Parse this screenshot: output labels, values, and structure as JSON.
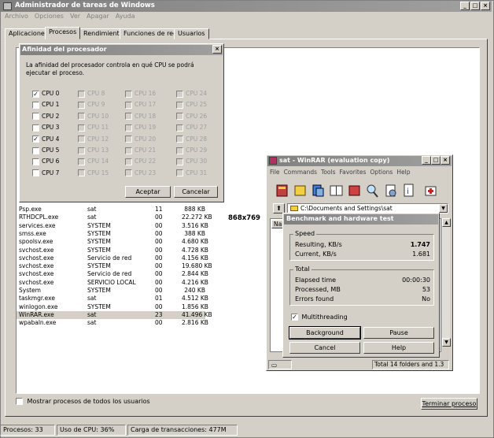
{
  "taskmgr": {
    "title": "Administrador de tareas de Windows",
    "menu": [
      "Archivo",
      "Opciones",
      "Ver",
      "Apagar",
      "Ayuda"
    ],
    "tabs": [
      "Aplicaciones",
      "Procesos",
      "Rendimiento",
      "Funciones de red",
      "Usuarios"
    ],
    "active_tab": "Procesos",
    "processes": [
      {
        "name": "Psp.exe",
        "user": "sat",
        "cpu": "11",
        "mem": "888 KB"
      },
      {
        "name": "RTHDCPL.exe",
        "user": "sat",
        "cpu": "00",
        "mem": "22.272 KB"
      },
      {
        "name": "services.exe",
        "user": "SYSTEM",
        "cpu": "00",
        "mem": "3.516 KB"
      },
      {
        "name": "smss.exe",
        "user": "SYSTEM",
        "cpu": "00",
        "mem": "388 KB"
      },
      {
        "name": "spoolsv.exe",
        "user": "SYSTEM",
        "cpu": "00",
        "mem": "4.680 KB"
      },
      {
        "name": "svchost.exe",
        "user": "SYSTEM",
        "cpu": "00",
        "mem": "4.728 KB"
      },
      {
        "name": "svchost.exe",
        "user": "Servicio de red",
        "cpu": "00",
        "mem": "4.156 KB"
      },
      {
        "name": "svchost.exe",
        "user": "SYSTEM",
        "cpu": "00",
        "mem": "19.680 KB"
      },
      {
        "name": "svchost.exe",
        "user": "Servicio de red",
        "cpu": "00",
        "mem": "2.844 KB"
      },
      {
        "name": "svchost.exe",
        "user": "SERVICIO LOCAL",
        "cpu": "00",
        "mem": "4.216 KB"
      },
      {
        "name": "System",
        "user": "SYSTEM",
        "cpu": "00",
        "mem": "240 KB"
      },
      {
        "name": "taskmgr.exe",
        "user": "sat",
        "cpu": "01",
        "mem": "4.512 KB"
      },
      {
        "name": "winlogon.exe",
        "user": "SYSTEM",
        "cpu": "00",
        "mem": "1.856 KB"
      },
      {
        "name": "WinRAR.exe",
        "user": "sat",
        "cpu": "23",
        "mem": "41.496 KB"
      },
      {
        "name": "wpabaln.exe",
        "user": "sat",
        "cpu": "00",
        "mem": "2.816 KB"
      }
    ],
    "selected_row": "WinRAR.exe",
    "resolution_label": "868x769",
    "show_all_users": "Mostrar procesos de todos los usuarios",
    "end_process": "Terminar proceso",
    "status": {
      "processes": "Procesos: 33",
      "cpu": "Uso de CPU: 36%",
      "commit": "Carga de transacciones: 477M"
    }
  },
  "affinity": {
    "title": "Afinidad del procesador",
    "description": "La afinidad del procesador controla en qué CPU se podrá ejecutar el proceso.",
    "cpus": [
      {
        "label": "CPU 0",
        "checked": true,
        "enabled": true
      },
      {
        "label": "CPU 1",
        "checked": false,
        "enabled": true
      },
      {
        "label": "CPU 2",
        "checked": false,
        "enabled": true
      },
      {
        "label": "CPU 3",
        "checked": false,
        "enabled": true
      },
      {
        "label": "CPU 4",
        "checked": true,
        "enabled": true
      },
      {
        "label": "CPU 5",
        "checked": false,
        "enabled": true
      },
      {
        "label": "CPU 6",
        "checked": false,
        "enabled": true
      },
      {
        "label": "CPU 7",
        "checked": false,
        "enabled": true
      },
      {
        "label": "CPU 8",
        "checked": false,
        "enabled": false
      },
      {
        "label": "CPU 9",
        "checked": false,
        "enabled": false
      },
      {
        "label": "CPU 10",
        "checked": false,
        "enabled": false
      },
      {
        "label": "CPU 11",
        "checked": false,
        "enabled": false
      },
      {
        "label": "CPU 12",
        "checked": false,
        "enabled": false
      },
      {
        "label": "CPU 13",
        "checked": false,
        "enabled": false
      },
      {
        "label": "CPU 14",
        "checked": false,
        "enabled": false
      },
      {
        "label": "CPU 15",
        "checked": false,
        "enabled": false
      },
      {
        "label": "CPU 16",
        "checked": false,
        "enabled": false
      },
      {
        "label": "CPU 17",
        "checked": false,
        "enabled": false
      },
      {
        "label": "CPU 18",
        "checked": false,
        "enabled": false
      },
      {
        "label": "CPU 19",
        "checked": false,
        "enabled": false
      },
      {
        "label": "CPU 20",
        "checked": false,
        "enabled": false
      },
      {
        "label": "CPU 21",
        "checked": false,
        "enabled": false
      },
      {
        "label": "CPU 22",
        "checked": false,
        "enabled": false
      },
      {
        "label": "CPU 23",
        "checked": false,
        "enabled": false
      },
      {
        "label": "CPU 24",
        "checked": false,
        "enabled": false
      },
      {
        "label": "CPU 25",
        "checked": false,
        "enabled": false
      },
      {
        "label": "CPU 26",
        "checked": false,
        "enabled": false
      },
      {
        "label": "CPU 27",
        "checked": false,
        "enabled": false
      },
      {
        "label": "CPU 28",
        "checked": false,
        "enabled": false
      },
      {
        "label": "CPU 29",
        "checked": false,
        "enabled": false
      },
      {
        "label": "CPU 30",
        "checked": false,
        "enabled": false
      },
      {
        "label": "CPU 31",
        "checked": false,
        "enabled": false
      }
    ],
    "accept": "Aceptar",
    "cancel": "Cancelar"
  },
  "winrar": {
    "title": "sat - WinRAR (evaluation copy)",
    "menu": [
      "File",
      "Commands",
      "Tools",
      "Favorites",
      "Options",
      "Help"
    ],
    "path": "C:\\Documents and Settings\\sat",
    "list_header": "Nam",
    "status_right": "Total 14 folders and 1.3",
    "bench": {
      "title": "Benchmark and hardware test",
      "speed_label": "Speed",
      "resulting_label": "Resulting, KB/s",
      "resulting_value": "1.747",
      "current_label": "Current, KB/s",
      "current_value": "1.681",
      "total_label": "Total",
      "elapsed_label": "Elapsed time",
      "elapsed_value": "00:00:30",
      "processed_label": "Processed, MB",
      "processed_value": "53",
      "errors_label": "Errors found",
      "errors_value": "No",
      "multithreading": "Multithreading",
      "background": "Background",
      "pause": "Pause",
      "cancel": "Cancel",
      "help": "Help"
    }
  }
}
